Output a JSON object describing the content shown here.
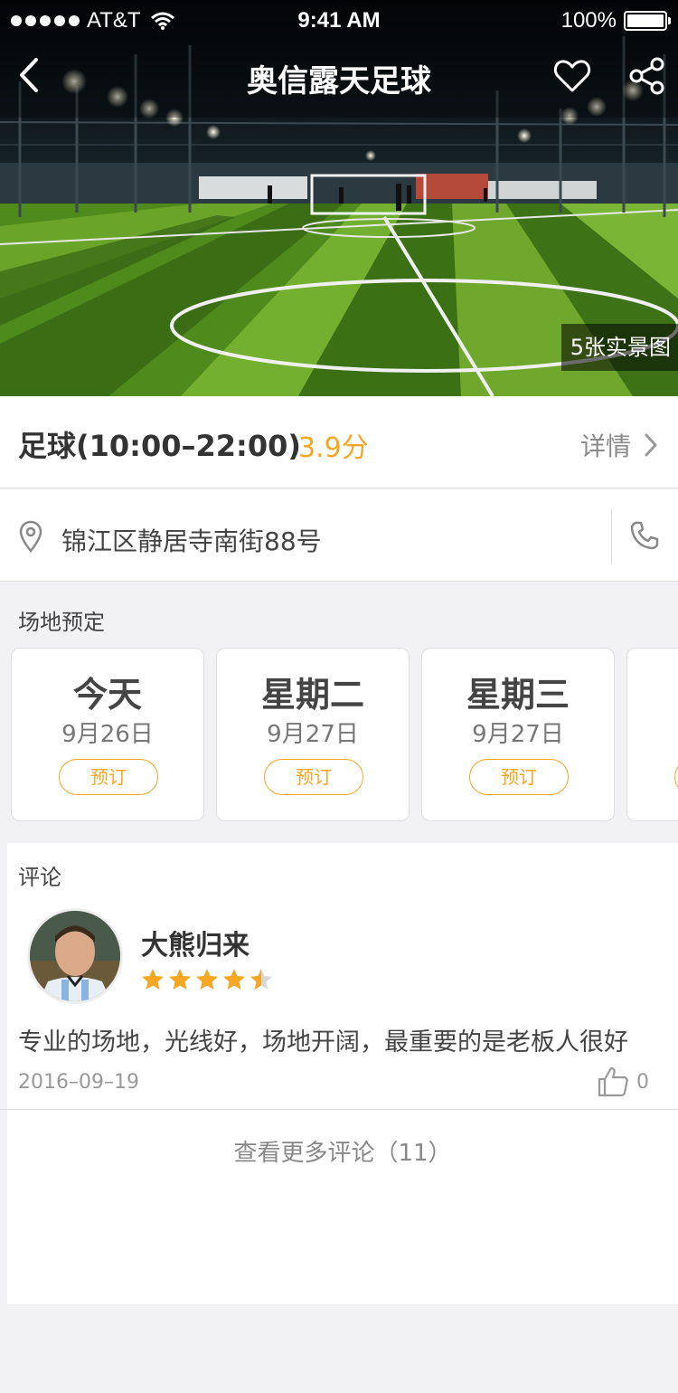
{
  "status_bar": {
    "carrier": "AT&T",
    "time": "9:41 AM",
    "battery": "100%"
  },
  "header": {
    "title": "奥信露天足球",
    "photo_count_label": "5张实景图"
  },
  "venue": {
    "sport_hours": "足球(10:00–22:00)",
    "score": "3.9分",
    "details_label": "详情",
    "address": "锦江区静居寺南街88号"
  },
  "booking": {
    "title": "场地预定",
    "days": [
      {
        "day": "今天",
        "date": "9月26日",
        "button": "预订"
      },
      {
        "day": "星期二",
        "date": "9月27日",
        "button": "预订"
      },
      {
        "day": "星期三",
        "date": "9月27日",
        "button": "预订"
      }
    ]
  },
  "reviews": {
    "title": "评论",
    "items": [
      {
        "user": "大熊归来",
        "rating": 4.5,
        "text": "专业的场地，光线好，场地开阔，最重要的是老板人很好",
        "date": "2016–09–19",
        "likes": "0"
      }
    ],
    "more_label": "查看更多评论（11）"
  },
  "colors": {
    "accent": "#f5a623",
    "text_primary": "#333333",
    "text_secondary": "#8a8a8a",
    "background": "#f2f2f4"
  },
  "icons": [
    "back-arrow-icon",
    "heart-icon",
    "share-icon",
    "location-pin-icon",
    "phone-icon",
    "chevron-right-icon",
    "star-icon",
    "thumbs-up-icon"
  ]
}
